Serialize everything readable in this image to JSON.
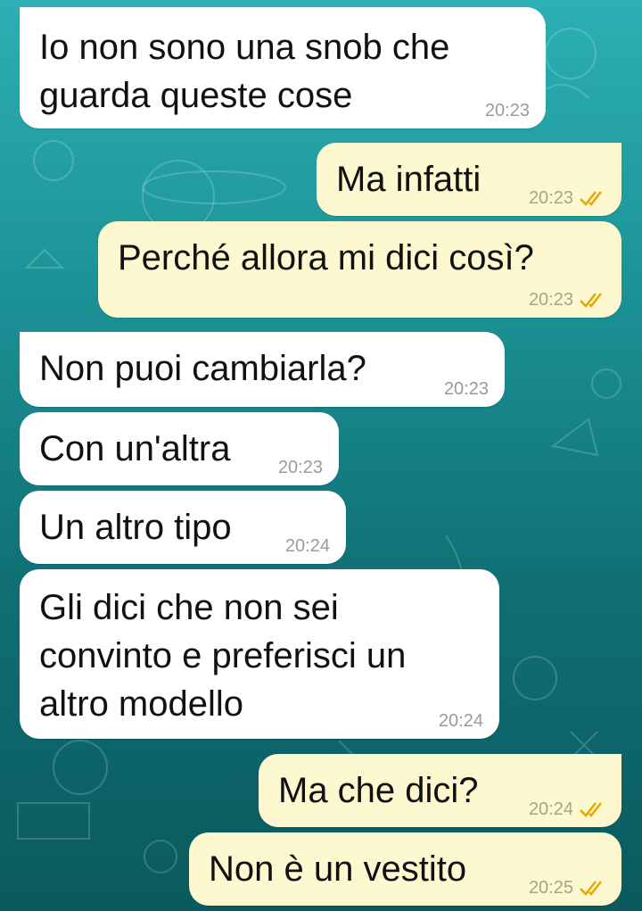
{
  "chat": {
    "messages": [
      {
        "dir": "in",
        "text": "Io non sono una snob che\nguarda queste cose",
        "time": "20:23"
      },
      {
        "dir": "out",
        "text": "Ma infatti",
        "time": "20:23"
      },
      {
        "dir": "out",
        "text": "Perché allora mi dici così?",
        "time": "20:23"
      },
      {
        "dir": "in",
        "text": "Non puoi cambiarla?",
        "time": "20:23"
      },
      {
        "dir": "in",
        "text": "Con un'altra",
        "time": "20:23"
      },
      {
        "dir": "in",
        "text": "Un altro tipo",
        "time": "20:24"
      },
      {
        "dir": "in",
        "text": "Gli dici che non sei\nconvinto e preferisci un\naltro modello",
        "time": "20:24"
      },
      {
        "dir": "out",
        "text": "Ma che dici?",
        "time": "20:24"
      },
      {
        "dir": "out",
        "text": "Non è un vestito",
        "time": "20:25"
      }
    ]
  },
  "colors": {
    "incoming_bubble": "#ffffff",
    "outgoing_bubble": "#fdf8cf",
    "read_ticks": "#e8a600"
  }
}
